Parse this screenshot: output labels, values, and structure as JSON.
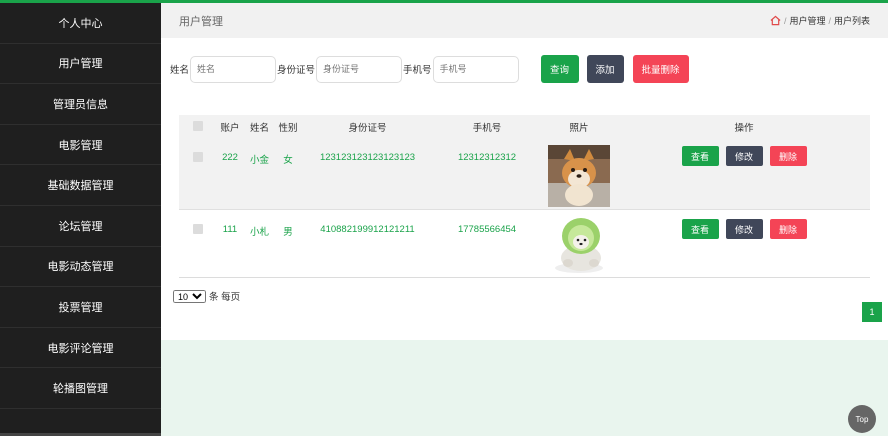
{
  "sidebar": {
    "items": [
      {
        "label": "个人中心"
      },
      {
        "label": "用户管理"
      },
      {
        "label": "管理员信息"
      },
      {
        "label": "电影管理"
      },
      {
        "label": "基础数据管理"
      },
      {
        "label": "论坛管理"
      },
      {
        "label": "电影动态管理"
      },
      {
        "label": "投票管理"
      },
      {
        "label": "电影评论管理"
      },
      {
        "label": "轮播图管理"
      }
    ]
  },
  "header": {
    "title": "用户管理",
    "breadcrumb": [
      "用户管理",
      "用户列表"
    ]
  },
  "search": {
    "name_label": "姓名",
    "name_placeholder": "姓名",
    "id_label": "身份证号",
    "id_placeholder": "身份证号",
    "phone_label": "手机号",
    "phone_placeholder": "手机号",
    "query_label": "查询",
    "add_label": "添加",
    "batch_delete_label": "批量删除"
  },
  "table": {
    "headers": [
      "账户",
      "姓名",
      "性别",
      "身份证号",
      "手机号",
      "照片",
      "操作"
    ],
    "rows": [
      {
        "account": "222",
        "name": "小金",
        "gender": "女",
        "id_number": "123123123123123123",
        "phone": "12312312312",
        "photo_icon": "shiba-dog-photo"
      },
      {
        "account": "111",
        "name": "小札",
        "gender": "男",
        "id_number": "410882199912121211",
        "phone": "17785566454",
        "photo_icon": "cabbage-dog-photo"
      }
    ],
    "view_label": "查看",
    "edit_label": "修改",
    "delete_label": "删除"
  },
  "pager": {
    "page_size": "10",
    "page_size_suffix": "条 每页",
    "current_page": "1"
  },
  "top_button": "Top",
  "colors": {
    "accent": "#1aa34a",
    "dark_button": "#404759",
    "danger": "#f44456",
    "sidebar_bg": "#1f1f1f"
  }
}
